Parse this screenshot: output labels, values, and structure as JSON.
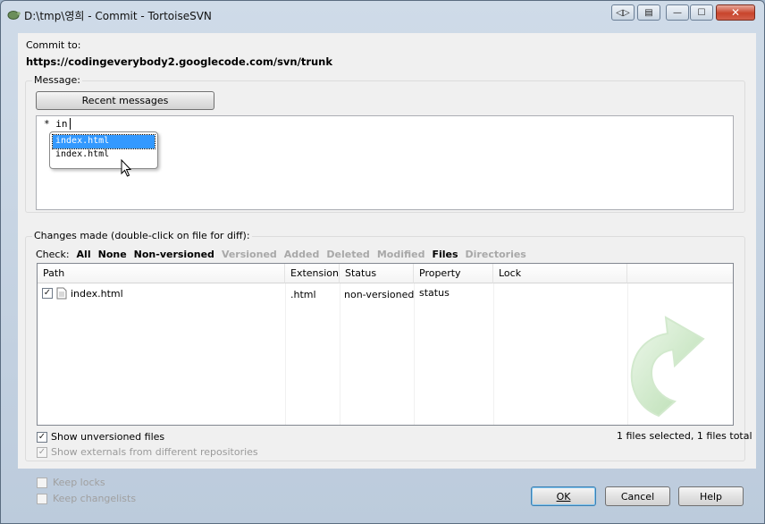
{
  "window": {
    "title": "D:\\tmp\\영희 - Commit - TortoiseSVN",
    "buttons": {
      "restore_label": "⧉",
      "minimize_label": "—",
      "maximize_label": "☐",
      "close_label": "✕",
      "extra1_label": "◁▷",
      "extra2_label": "▤"
    }
  },
  "commit": {
    "commit_to_label": "Commit to:",
    "url": "https://codingeverybody2.googlecode.com/svn/trunk",
    "message_label": "Message:",
    "recent_messages_button": "Recent messages",
    "message_text": "* in",
    "autocomplete": [
      "index.html",
      "index.html"
    ]
  },
  "changes": {
    "label": "Changes made (double-click on file for diff):",
    "check_label": "Check:",
    "filters": [
      {
        "label": "All",
        "enabled": true
      },
      {
        "label": "None",
        "enabled": true
      },
      {
        "label": "Non-versioned",
        "enabled": true
      },
      {
        "label": "Versioned",
        "enabled": false
      },
      {
        "label": "Added",
        "enabled": false
      },
      {
        "label": "Deleted",
        "enabled": false
      },
      {
        "label": "Modified",
        "enabled": false
      },
      {
        "label": "Files",
        "enabled": true
      },
      {
        "label": "Directories",
        "enabled": false
      }
    ],
    "columns": [
      "Path",
      "Extension",
      "Status",
      "Property status",
      "Lock"
    ],
    "rows": [
      {
        "checked": true,
        "path": "index.html",
        "extension": ".html",
        "status": "non-versioned",
        "property_status": "",
        "lock": ""
      }
    ],
    "show_unversioned_label": "Show unversioned files",
    "show_externals_label": "Show externals from different repositories",
    "selection_summary": "1 files selected, 1 files total"
  },
  "footer": {
    "keep_locks_label": "Keep locks",
    "keep_changelists_label": "Keep changelists",
    "ok_label": "OK",
    "cancel_label": "Cancel",
    "help_label": "Help"
  },
  "colors": {
    "accent": "#3399ff",
    "disabled_text": "#a8a8a8",
    "close_button": "#c8442c",
    "watermark_arrow": "#c9e8c4"
  },
  "icons": {
    "app": "tortoise-icon",
    "file": "file-icon",
    "watermark": "curved-arrow-icon",
    "cursor": "mouse-pointer-icon"
  }
}
